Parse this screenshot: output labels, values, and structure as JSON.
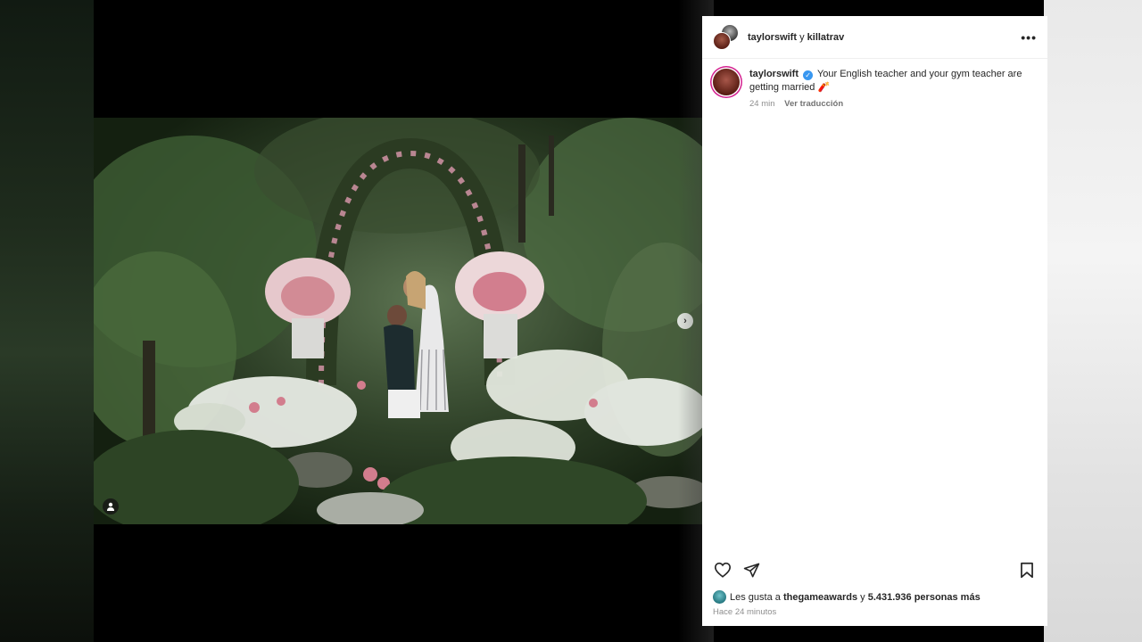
{
  "post": {
    "header_user_1": "taylorswift",
    "header_sep": " y ",
    "header_user_2": "killatrav",
    "caption_user": "taylorswift",
    "caption_text": "Your English teacher and your gym teacher are getting married",
    "caption_emoji": "🧨",
    "posted_rel": "24 min",
    "translate_label": "Ver traducción",
    "likes_prefix": "Les gusta a ",
    "likes_user": "thegameawards",
    "likes_mid": " y ",
    "likes_count": "5.431.936 personas más",
    "time_ago": "Hace 24 minutos"
  },
  "icons": {
    "more": "more-options-icon",
    "like": "heart-icon",
    "share": "send-icon",
    "save": "bookmark-icon",
    "next": "chevron-right-icon",
    "tag": "person-tag-icon",
    "verified": "verified-badge-icon"
  },
  "colors": {
    "verified": "#3897f0",
    "story_ring": "#d4208f",
    "text_primary": "#262626",
    "text_secondary": "#8e8e8e"
  }
}
